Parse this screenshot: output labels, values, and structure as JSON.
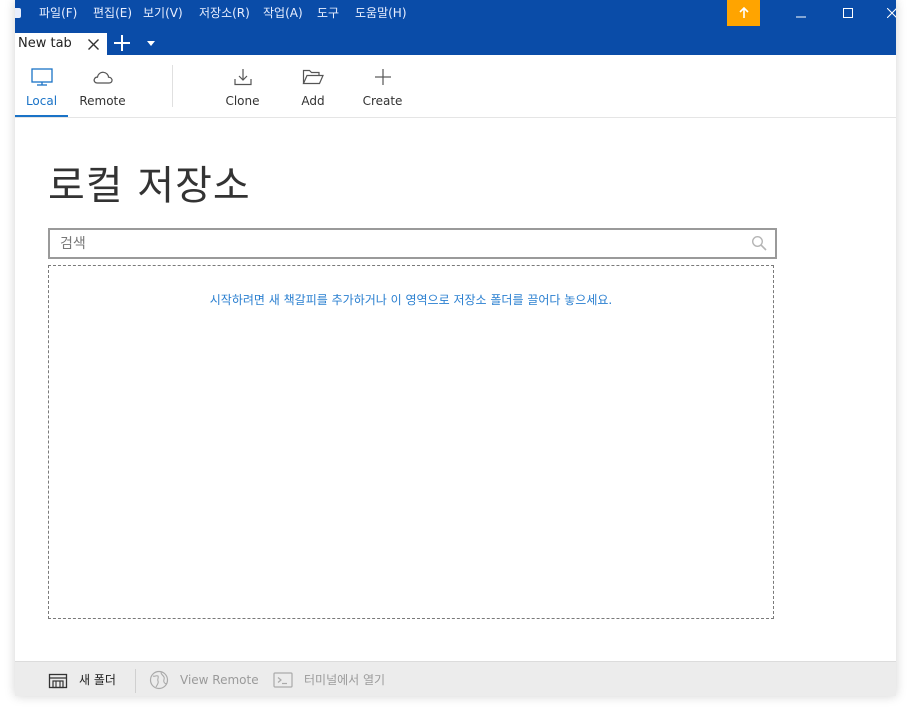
{
  "menu": {
    "items": [
      "파일(F)",
      "편집(E)",
      "보기(V)",
      "저장소(R)",
      "작업(A)",
      "도구",
      "도움말(H)"
    ]
  },
  "titlebar": {
    "notify_icon": "arrow-up-icon",
    "accent": "#0a4ca8",
    "notify_color": "#ffa400"
  },
  "tabs": {
    "active_title": "New tab",
    "close_icon": "close-icon",
    "add_icon": "plus-icon",
    "dropdown_icon": "chevron-down-icon"
  },
  "toolbar": {
    "local_label": "Local",
    "remote_label": "Remote",
    "clone_label": "Clone",
    "add_label": "Add",
    "create_label": "Create"
  },
  "main": {
    "title": "로컬 저장소",
    "search_placeholder": "검색",
    "empty_hint": "시작하려면 새 책갈피를 추가하거나 이 영역으로 저장소 폴더를 끌어다 놓으세요."
  },
  "statusbar": {
    "new_folder_label": "새 폴더",
    "view_remote_label": "View Remote",
    "terminal_label": "터미널에서 열기"
  }
}
